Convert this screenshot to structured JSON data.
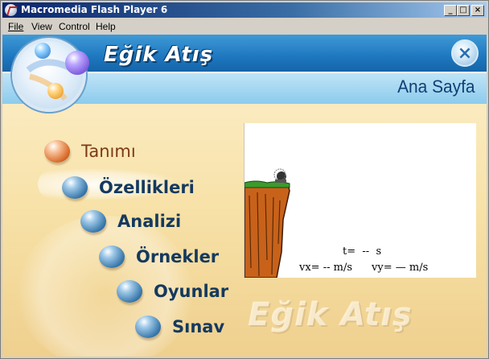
{
  "window": {
    "title": "Macromedia Flash Player 6",
    "controls": {
      "minimize": "_",
      "maximize": "□",
      "close": "×"
    }
  },
  "menubar": {
    "items": [
      {
        "label": "File"
      },
      {
        "label": "View"
      },
      {
        "label": "Control"
      },
      {
        "label": "Help"
      }
    ]
  },
  "header": {
    "title": "Eğik Atış",
    "page_label": "Ana Sayfa",
    "close_glyph": "×"
  },
  "nav": {
    "active_index": 0,
    "items": [
      {
        "label": "Tanımı"
      },
      {
        "label": "Özellikleri"
      },
      {
        "label": "Analizi"
      },
      {
        "label": "Örnekler"
      },
      {
        "label": "Oyunlar"
      },
      {
        "label": "Sınav"
      }
    ]
  },
  "simulation": {
    "time_label": "t=",
    "time_value": "--",
    "time_unit": "s",
    "vx_label": "vx=",
    "vx_value": "--",
    "vx_unit": "m/s",
    "vy_label": "vy=",
    "vy_value": "—",
    "vy_unit": "m/s"
  },
  "watermark": {
    "title": "Eğik Atış"
  },
  "colors": {
    "header_blue": "#1d76be",
    "subheader_blue": "#8ccbed",
    "stage_cream": "#f7e1a7",
    "nav_text": "#14395e",
    "nav_active_text": "#7a3a18",
    "cliff_brown": "#c8621a",
    "grass_green": "#3c9a2c"
  }
}
